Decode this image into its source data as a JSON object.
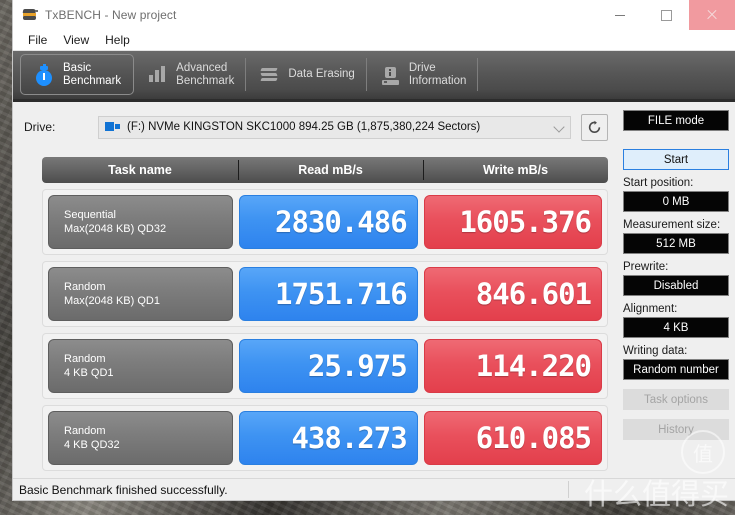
{
  "window": {
    "title": "TxBENCH - New project",
    "app_icon": "txbench-icon",
    "controls": {
      "minimize": "minimize-icon",
      "maximize": "maximize-icon",
      "close": "close-icon"
    }
  },
  "menubar": {
    "items": [
      "File",
      "View",
      "Help"
    ]
  },
  "tabs": [
    {
      "label": "Basic\nBenchmark",
      "icon": "stopwatch-icon",
      "active": true
    },
    {
      "label": "Advanced\nBenchmark",
      "icon": "bar-chart-icon",
      "active": false
    },
    {
      "label": "Data Erasing",
      "icon": "shredder-icon",
      "active": false
    },
    {
      "label": "Drive\nInformation",
      "icon": "drive-info-icon",
      "active": false
    }
  ],
  "drive": {
    "label": "Drive:",
    "selected": "(F:) NVMe KINGSTON SKC1000  894.25 GB (1,875,380,224 Sectors)",
    "refresh_icon": "refresh-icon"
  },
  "results": {
    "headers": [
      "Task name",
      "Read mB/s",
      "Write mB/s"
    ],
    "rows": [
      {
        "name_line1": "Sequential",
        "name_line2": "Max(2048 KB) QD32",
        "read": "2830.486",
        "write": "1605.376"
      },
      {
        "name_line1": "Random",
        "name_line2": "Max(2048 KB) QD1",
        "read": "1751.716",
        "write": "846.601"
      },
      {
        "name_line1": "Random",
        "name_line2": "4 KB QD1",
        "read": "25.975",
        "write": "114.220"
      },
      {
        "name_line1": "Random",
        "name_line2": "4 KB QD32",
        "read": "438.273",
        "write": "610.085"
      }
    ]
  },
  "sidepanel": {
    "mode_button": "FILE mode",
    "start_button": "Start",
    "start_position_label": "Start position:",
    "start_position_value": "0 MB",
    "measurement_size_label": "Measurement size:",
    "measurement_size_value": "512 MB",
    "prewrite_label": "Prewrite:",
    "prewrite_value": "Disabled",
    "alignment_label": "Alignment:",
    "alignment_value": "4 KB",
    "writing_data_label": "Writing data:",
    "writing_data_value": "Random number",
    "task_options_button": "Task options",
    "history_button": "History"
  },
  "statusbar": {
    "message": "Basic Benchmark finished successfully."
  },
  "watermark": {
    "mark": "值",
    "text": "什么值得买"
  },
  "colors": {
    "read_accent": "#3e93f2",
    "write_accent": "#e9505c",
    "close_button": "#f19a9f",
    "start_border": "#2a7fe0"
  }
}
